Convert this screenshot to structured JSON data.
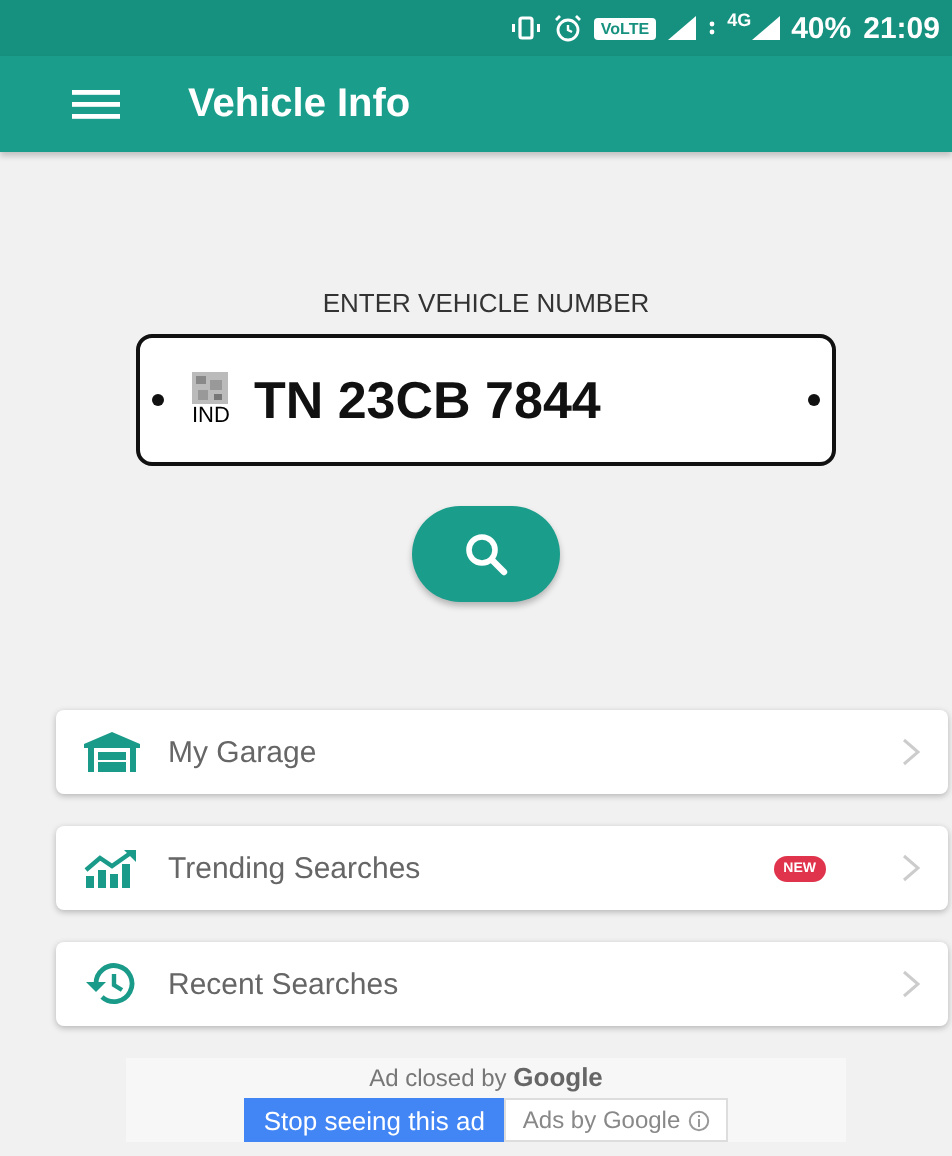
{
  "status_bar": {
    "network_badge": "VoLTE",
    "data_type": "4G",
    "battery": "40%",
    "time": "21:09"
  },
  "app_bar": {
    "title": "Vehicle Info"
  },
  "plate": {
    "heading": "ENTER VEHICLE NUMBER",
    "country": "IND",
    "number": "TN 23CB 7844"
  },
  "menu": [
    {
      "label": "My Garage"
    },
    {
      "label": "Trending Searches",
      "badge": "NEW"
    },
    {
      "label": "Recent Searches"
    }
  ],
  "ad": {
    "notice": "Ad closed by",
    "brand": "Google",
    "buttons": [
      "Stop seeing this ad",
      "Ads by Google"
    ]
  }
}
